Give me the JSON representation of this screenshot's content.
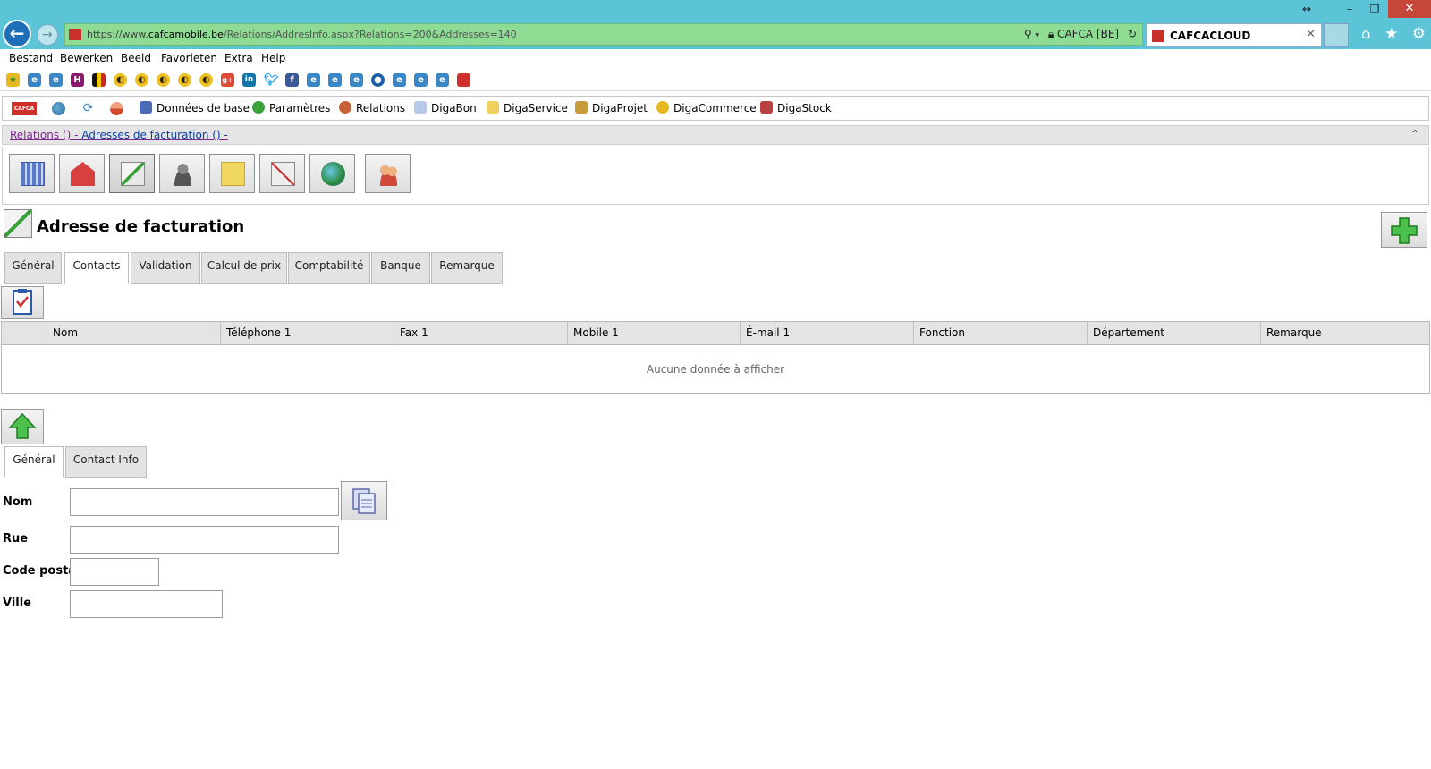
{
  "browser": {
    "url_prefix": "https://www.",
    "url_domain": "cafcamobile.be",
    "url_path": "/Relations/AddresInfo.aspx?Relations=200&Addresses=140",
    "site_identity": "CAFCA [BE]",
    "tab_title": "CAFCACLOUD",
    "menu": [
      "Bestand",
      "Bewerken",
      "Beeld",
      "Favorieten",
      "Extra",
      "Help"
    ]
  },
  "appmenu": {
    "logo_text": "CAFCA",
    "items": [
      "Données de base",
      "Paramètres",
      "Relations",
      "DigaBon",
      "DigaService",
      "DigaProjet",
      "DigaCommerce",
      "DigaStock"
    ]
  },
  "breadcrumb": {
    "part1": "Relations () - ",
    "part2": "Adresses de facturation () -"
  },
  "page": {
    "title": "Adresse de facturation"
  },
  "tabs": [
    "Général",
    "Contacts",
    "Validation",
    "Calcul de prix",
    "Comptabilité",
    "Banque",
    "Remarque"
  ],
  "active_tab": "Contacts",
  "grid": {
    "columns": [
      "Nom",
      "Téléphone 1",
      "Fax 1",
      "Mobile 1",
      "É-mail 1",
      "Fonction",
      "Département",
      "Remarque"
    ],
    "empty_text": "Aucune donnée à afficher"
  },
  "subtabs": [
    "Général",
    "Contact Info"
  ],
  "form": {
    "nom_label": "Nom",
    "rue_label": "Rue",
    "cp_label": "Code postal",
    "ville_label": "Ville",
    "nom_value": "",
    "rue_value": "",
    "cp_value": "",
    "ville_value": ""
  },
  "colors": {
    "chrome": "#5bc4d6",
    "address_bar": "#8edb94",
    "brand_red": "#d0302c"
  }
}
